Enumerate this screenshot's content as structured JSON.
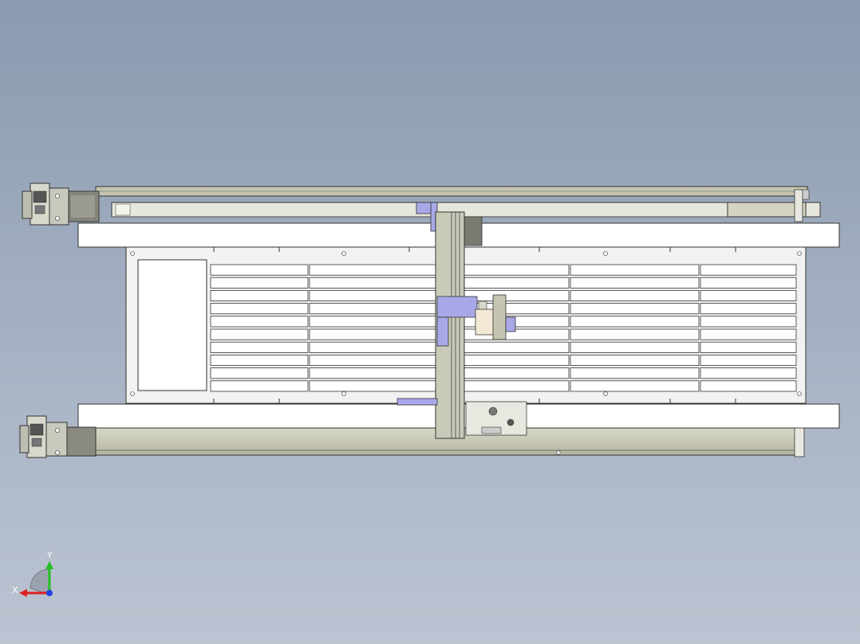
{
  "view": {
    "title": "",
    "background_top": "#8a9ab0",
    "background_bottom": "#bcc4d2"
  },
  "triad": {
    "x_label": "X",
    "y_label": "Y",
    "x_color": "#e02020",
    "y_color": "#20c020",
    "z_color": "#2040e0"
  },
  "model": {
    "table_slat_rows": 10,
    "table_slat_columns": 5,
    "gantry_color": "#c8cbb8",
    "highlight_color": "#a8a8e8"
  }
}
